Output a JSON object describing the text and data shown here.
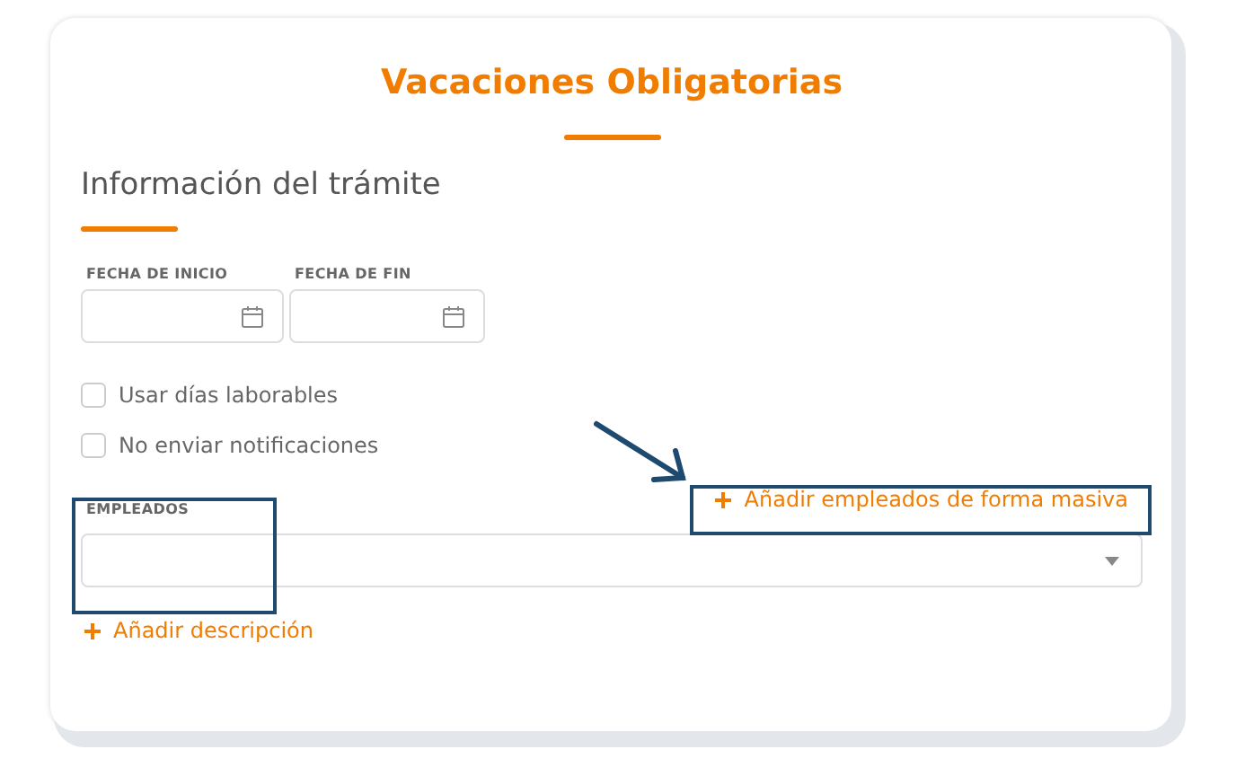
{
  "title": "Vacaciones Obligatorias",
  "section_heading": "Información del trámite",
  "date_fields": [
    {
      "label": "FECHA DE INICIO"
    },
    {
      "label": "FECHA DE FIN"
    }
  ],
  "checkboxes": [
    {
      "label": "Usar días laborables",
      "checked": false
    },
    {
      "label": "No enviar notificaciones",
      "checked": false
    }
  ],
  "employees": {
    "label": "EMPLEADOS",
    "bulk_link": "Añadir empleados de forma masiva"
  },
  "add_description_link": "Añadir descripción"
}
